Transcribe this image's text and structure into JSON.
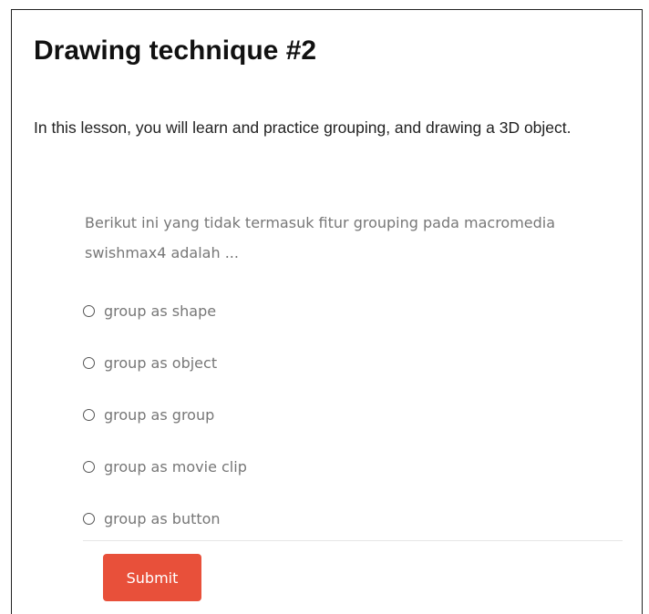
{
  "lesson": {
    "title": "Drawing technique #2",
    "intro": "In this lesson, you will learn and practice grouping, and drawing a 3D object."
  },
  "quiz": {
    "question": "Berikut ini yang tidak termasuk fitur grouping pada macromedia swishmax4 adalah ...",
    "options": [
      {
        "label": "group as shape"
      },
      {
        "label": "group as object"
      },
      {
        "label": "group as group"
      },
      {
        "label": "group as movie clip"
      },
      {
        "label": "group as button"
      }
    ],
    "submit_label": "Submit"
  },
  "colors": {
    "submit_button": "#e8503a",
    "text_muted": "#777777",
    "border": "#222222"
  }
}
